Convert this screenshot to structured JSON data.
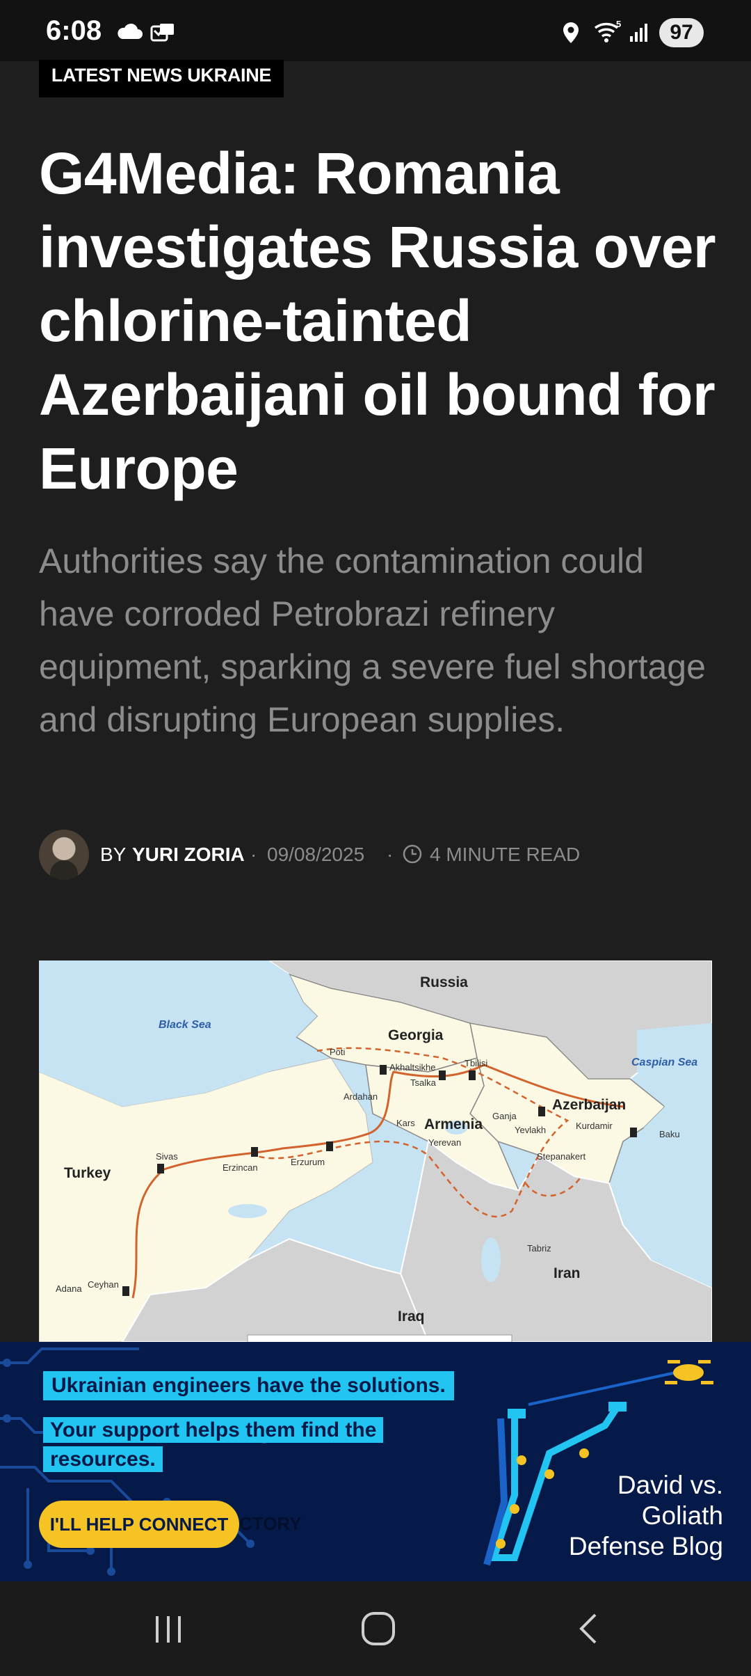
{
  "status_bar": {
    "time": "6:08",
    "battery": "97",
    "icons": [
      "cloud-icon",
      "notification-icon",
      "location-icon",
      "wifi-icon",
      "signal-icon"
    ]
  },
  "article": {
    "category": "LATEST NEWS UKRAINE",
    "headline": "G4Media: Romania investigates Russia over chlorine-tainted Azerbaijani oil bound for Europe",
    "subheading": "Authorities say the contamination could have corroded Petrobrazi refinery equipment, sparking a severe fuel shortage and disrupting European supplies.",
    "byline": {
      "by_label": "BY",
      "author": "YURI ZORIA",
      "date": "09/08/2025",
      "read_time": "4 MINUTE READ"
    }
  },
  "map": {
    "countries": [
      "Russia",
      "Georgia",
      "Azerbaijan",
      "Armenia",
      "Turkey",
      "Iran",
      "Iraq"
    ],
    "seas": [
      "Black Sea",
      "Caspian Sea"
    ],
    "cities": [
      "Poti",
      "Akhaltsikhe",
      "Tbilisi",
      "Tsalka",
      "Ardahan",
      "Kars",
      "Yerevan",
      "Ganja",
      "Yevlakh",
      "Kurdamir",
      "Baku",
      "Stepanakert",
      "Tabriz",
      "Sivas",
      "Erzincan",
      "Erzurum",
      "Adana",
      "Ceyhan"
    ]
  },
  "ad": {
    "line1": "Ukrainian engineers have the solutions.",
    "line2": "Your support helps them find the resources.",
    "cta": "I'LL HELP CONNECT",
    "partial_text": "CTORY",
    "brand": "David vs. Goliath Defense Blog",
    "colors": {
      "background": "#061a4a",
      "highlight": "#22c4f2",
      "cta": "#f6c324"
    }
  },
  "nav_bar": {
    "buttons": [
      "recent-apps-button",
      "home-button",
      "back-button"
    ]
  }
}
